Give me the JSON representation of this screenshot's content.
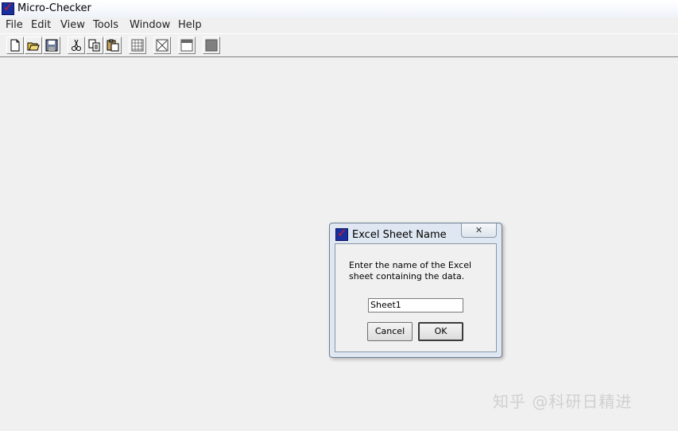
{
  "window": {
    "title": "Micro-Checker",
    "icon": "micro-checker-app-icon"
  },
  "menu": [
    "File",
    "Edit",
    "View",
    "Tools",
    "Window",
    "Help"
  ],
  "toolbar": {
    "buttons": [
      "new-document-icon",
      "open-folder-icon",
      "save-icon",
      "cut-icon",
      "copy-icon",
      "paste-icon",
      "grid-icon",
      "clear-icon",
      "window-icon",
      "stop-icon"
    ]
  },
  "dialog": {
    "title": "Excel Sheet Name",
    "close_symbol": "✕",
    "message": "Enter the name of the Excel sheet containing the data.",
    "input_value": "Sheet1",
    "cancel_label": "Cancel",
    "ok_label": "OK"
  },
  "watermark": "知乎 @科研日精进"
}
